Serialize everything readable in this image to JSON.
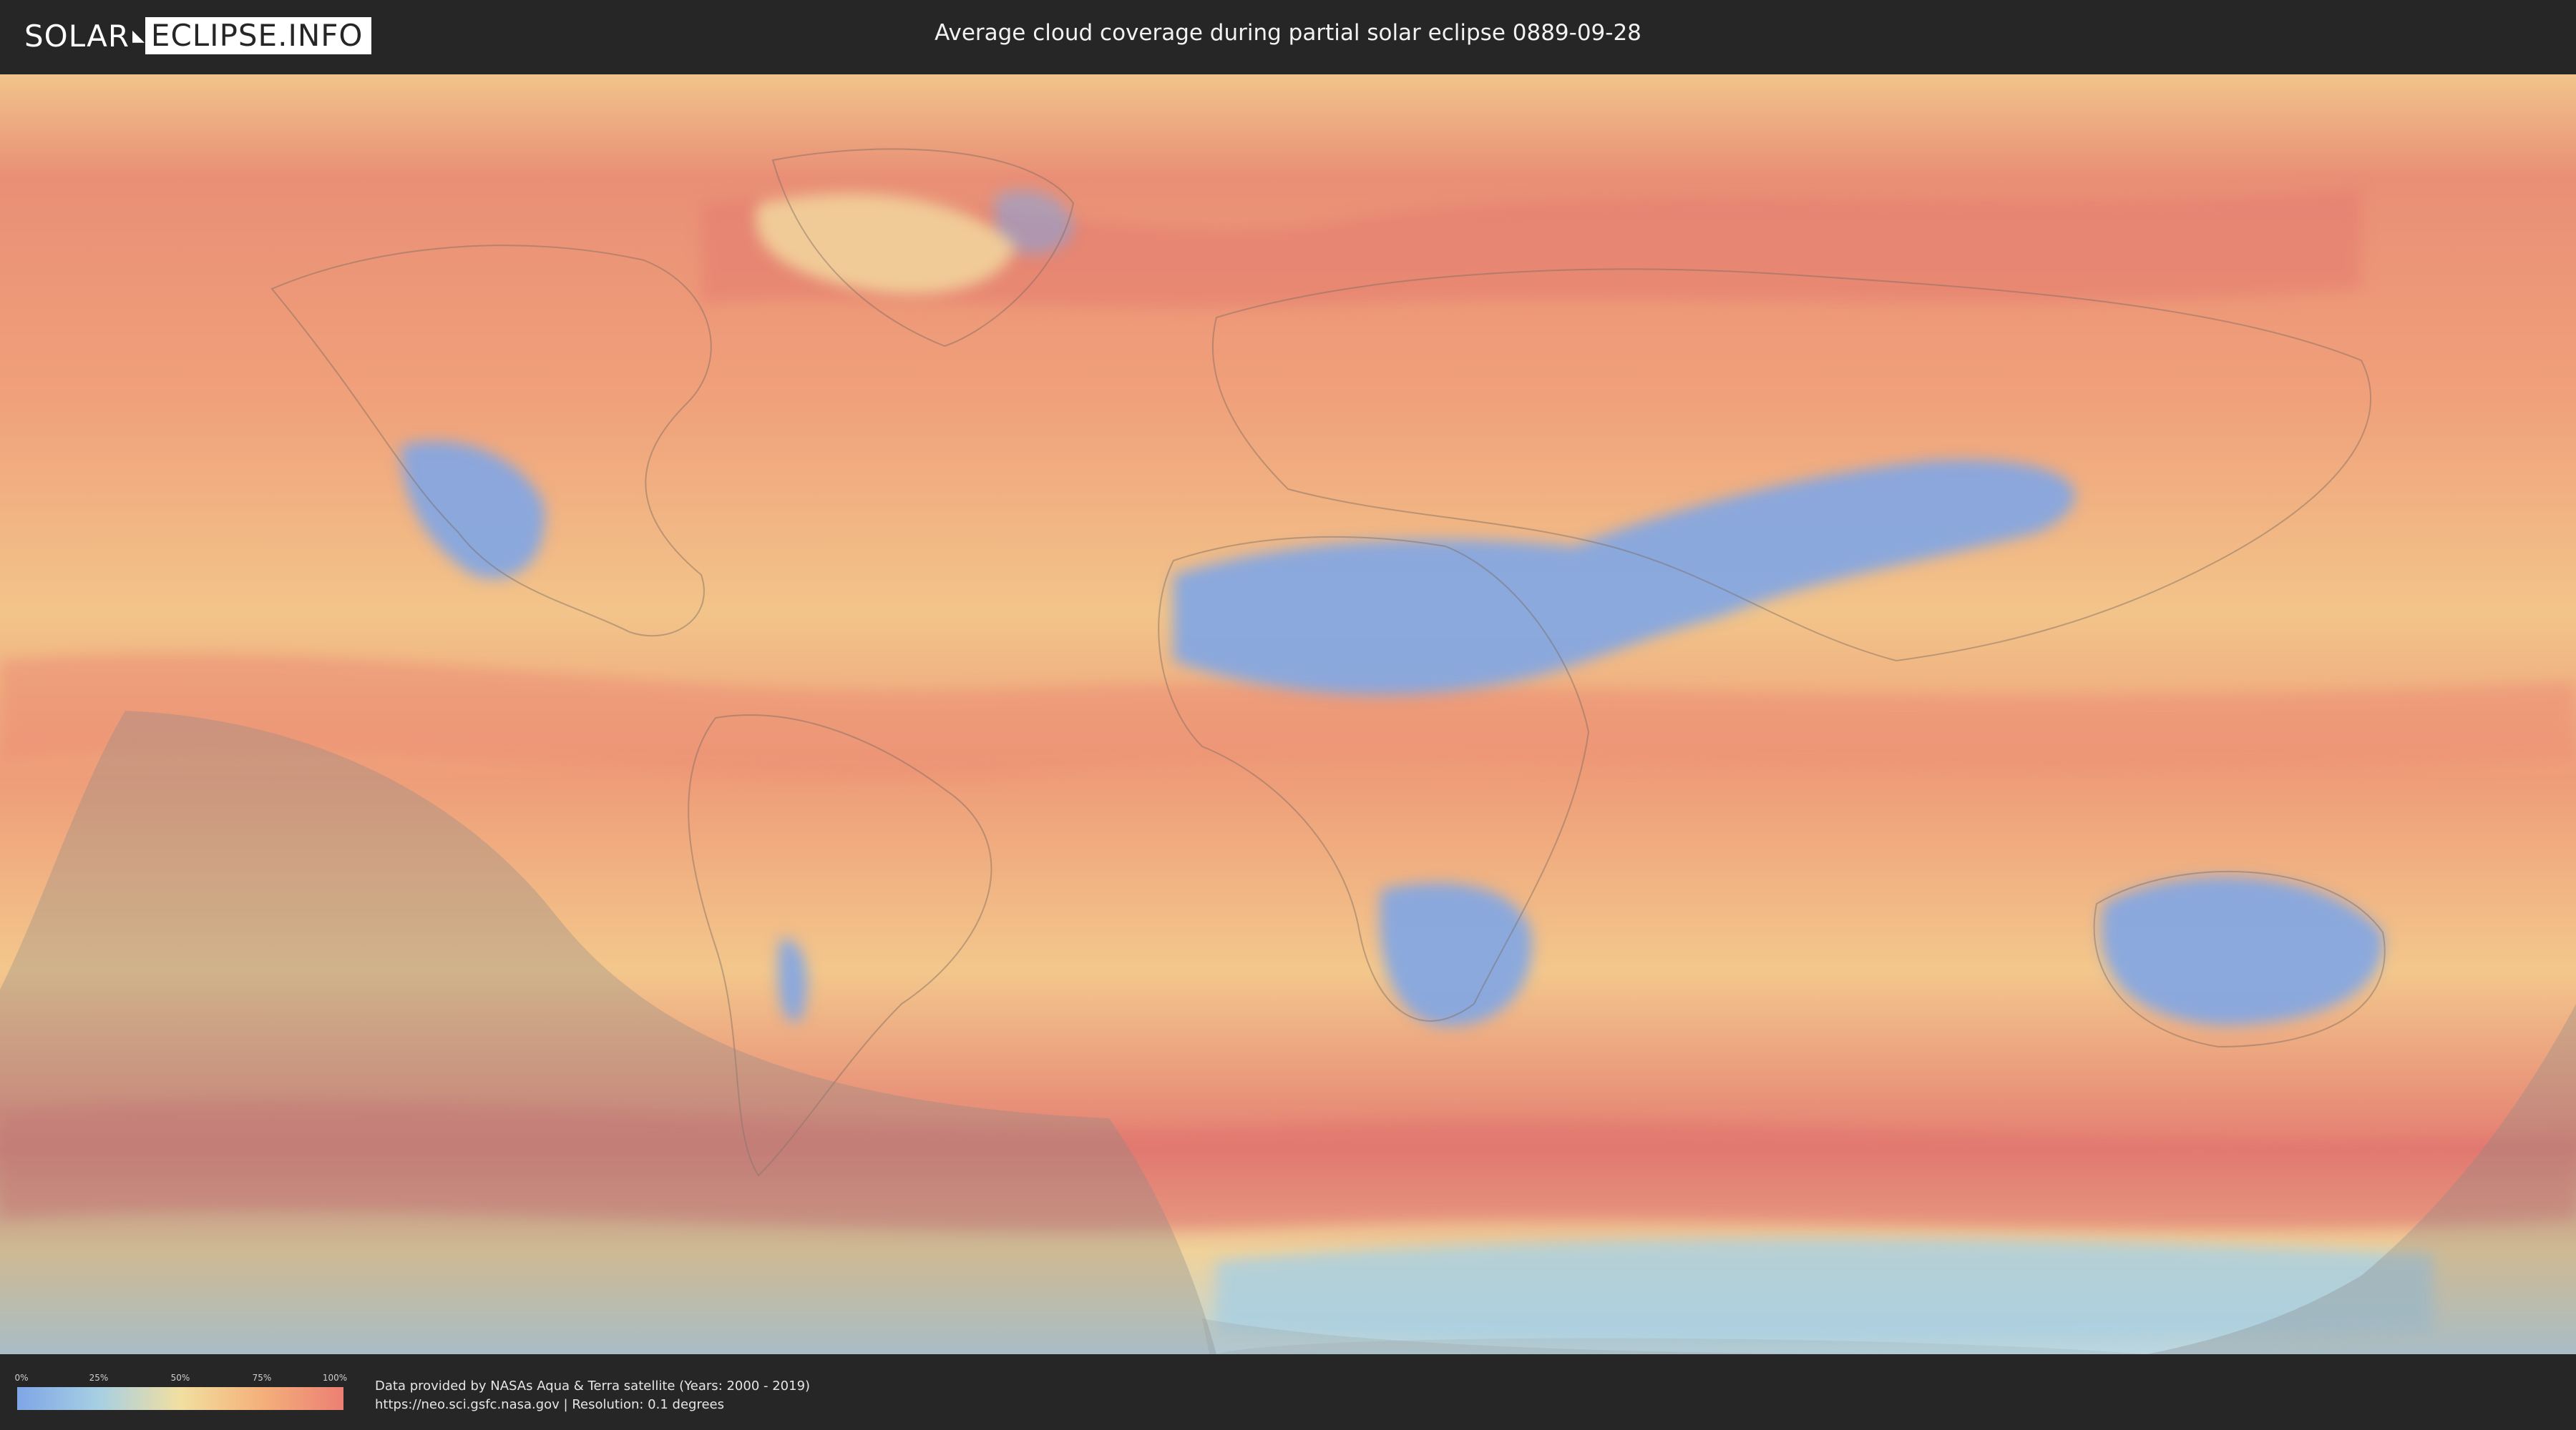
{
  "header": {
    "logo_left": "SOLAR",
    "logo_right": "ECLIPSE.INFO",
    "title": "Average cloud coverage during partial solar eclipse 0889-09-28"
  },
  "map": {
    "icon": "world-cloud-map",
    "colors": {
      "ocean_cloudy": "#e98a72",
      "mid": "#f2c48a",
      "clear": "#7fa6e6",
      "eclipse_shadow": "#8a8a8a"
    }
  },
  "legend": {
    "ticks": [
      "0%",
      "25%",
      "50%",
      "75%",
      "100%"
    ],
    "gradient": [
      "#7fa6e6",
      "#a7cfe3",
      "#f2dfa0",
      "#f4b07a",
      "#ec7f74"
    ]
  },
  "footer": {
    "credit_line1": "Data provided by NASAs Aqua & Terra satellite (Years: 2000 - 2019)",
    "credit_line2": "https://neo.sci.gsfc.nasa.gov | Resolution: 0.1 degrees"
  }
}
